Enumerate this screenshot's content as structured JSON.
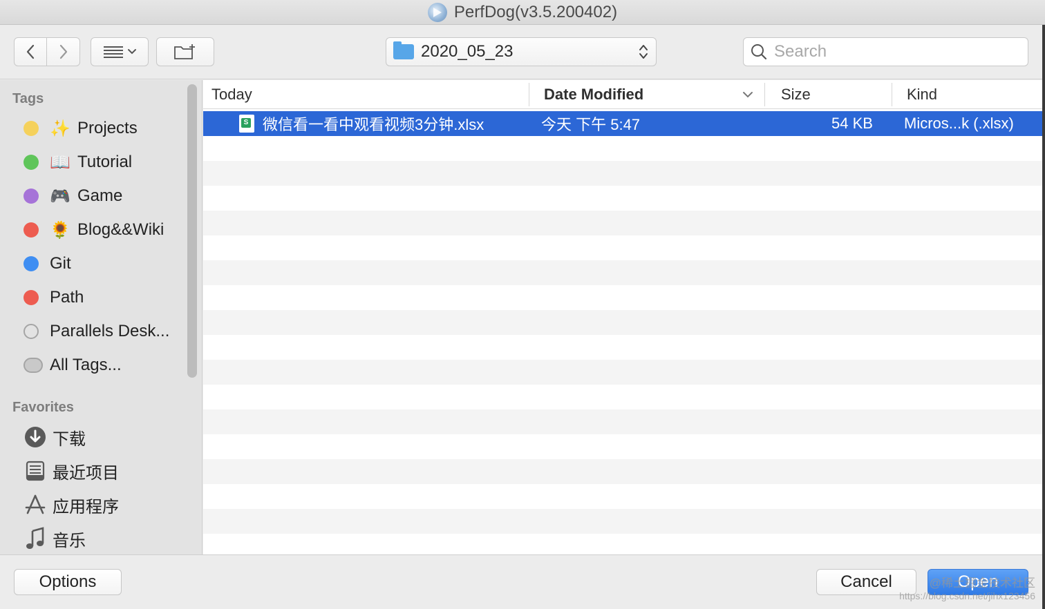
{
  "window": {
    "title": "PerfDog(v3.5.200402)"
  },
  "toolbar": {
    "back_icon": "chevron-left-icon",
    "forward_icon": "chevron-right-icon",
    "view_icon": "list-view-icon",
    "new_folder_icon": "new-folder-icon",
    "current_folder": "2020_05_23",
    "search_placeholder": "Search"
  },
  "sidebar": {
    "tags_heading": "Tags",
    "tags": [
      {
        "label": "Projects",
        "color": "#f5d15c",
        "emoji": "✨"
      },
      {
        "label": "Tutorial",
        "color": "#5fc55a",
        "emoji": "📖"
      },
      {
        "label": "Game",
        "color": "#a673d8",
        "emoji": "🎮"
      },
      {
        "label": "Blog&&Wiki",
        "color": "#ed5c50",
        "emoji": "🌻"
      },
      {
        "label": "Git",
        "color": "#3f8ef2"
      },
      {
        "label": "Path",
        "color": "#ed5c50"
      },
      {
        "label": "Parallels Desk..."
      },
      {
        "label": "All Tags..."
      }
    ],
    "favorites_heading": "Favorites",
    "favorites": [
      {
        "label": "下载",
        "icon": "download-icon"
      },
      {
        "label": "最近项目",
        "icon": "recents-icon"
      },
      {
        "label": "应用程序",
        "icon": "applications-icon"
      },
      {
        "label": "音乐",
        "icon": "music-icon"
      }
    ]
  },
  "file_list": {
    "columns": {
      "name": "Today",
      "date": "Date Modified",
      "size": "Size",
      "kind": "Kind"
    },
    "files": [
      {
        "name": "微信看一看中观看视频3分钟.xlsx",
        "date": "今天 下午 5:47",
        "size": "54 KB",
        "kind": "Micros...k (.xlsx)",
        "selected": true
      }
    ]
  },
  "footer": {
    "options_label": "Options",
    "cancel_label": "Cancel",
    "open_label": "Open",
    "watermark_line1": "@稀土掘金技术社区",
    "watermark_line2": "https://blog.csdn.net/jihx123456"
  },
  "colors": {
    "selection": "#2c67d6",
    "accent": "#2f7ae6"
  }
}
